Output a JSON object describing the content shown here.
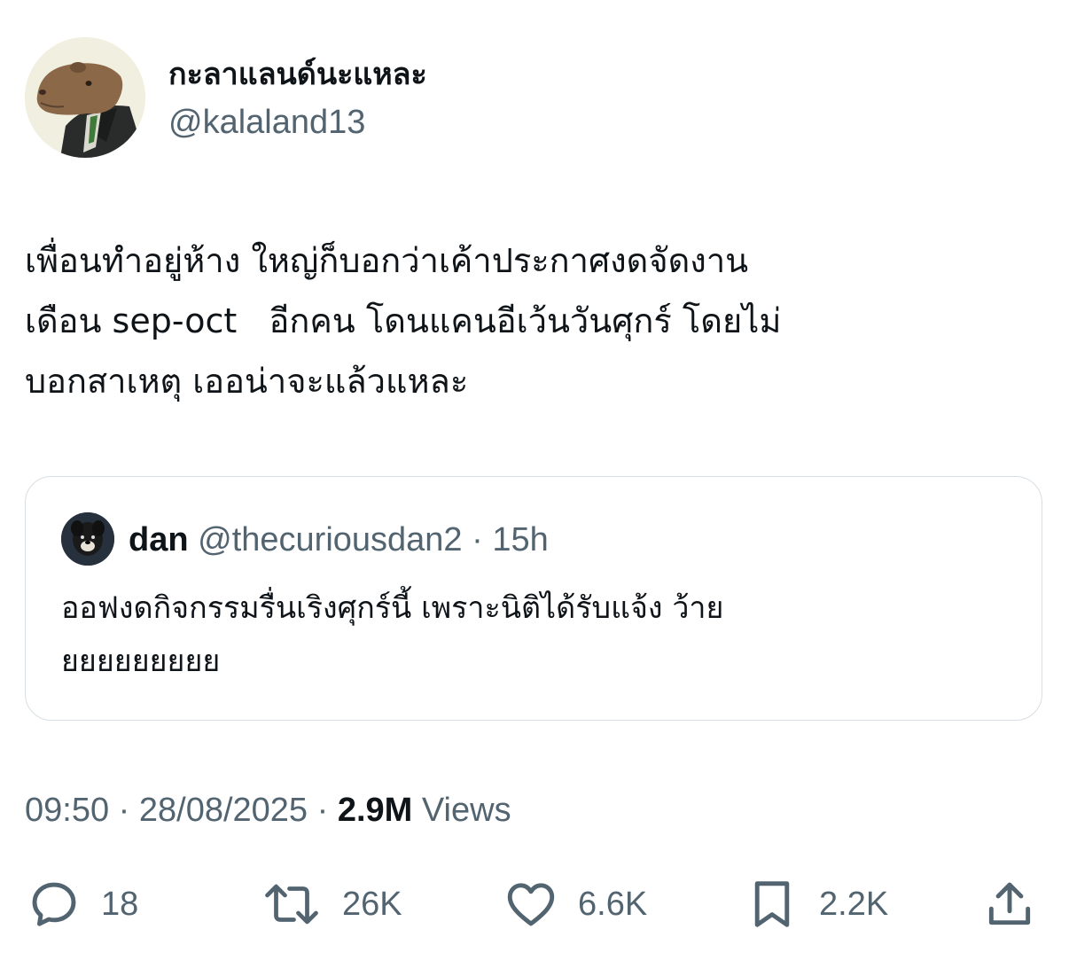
{
  "author": {
    "display_name": "กะลาแลนด์นะแหละ",
    "handle": "@kalaland13",
    "avatar_icon": "capybara-in-suit-avatar"
  },
  "tweet": {
    "lines": [
      "เพื่อนทำอยู่ห้าง ใหญ่ก็บอกว่าเค้าประกาศงดจัดงาน",
      "เดือน sep-oct   อีกคน โดนแคนอีเว้นวันศุกร์ โดยไม่",
      "บอกสาเหตุ เออน่าจะแล้วแหละ"
    ]
  },
  "quoted_tweet": {
    "name": "dan",
    "handle": "@thecuriousdan2",
    "separator": "·",
    "time": "15h",
    "avatar_icon": "dog-avatar",
    "lines": [
      "ออฟงดกิจกรรมรื่นเริงศุกร์นี้ เพราะนิติได้รับแจ้ง ว้าย",
      "ยยยยยยยยย"
    ]
  },
  "meta": {
    "time": "09:50",
    "sep1": "·",
    "date": "28/08/2025",
    "sep2": "·",
    "views_count": "2.9M",
    "views_label": "Views"
  },
  "actions": {
    "reply": {
      "icon": "reply-icon",
      "count": "18"
    },
    "retweet": {
      "icon": "retweet-icon",
      "count": "26K"
    },
    "like": {
      "icon": "heart-icon",
      "count": "6.6K"
    },
    "bookmark": {
      "icon": "bookmark-icon",
      "count": "2.2K"
    },
    "share": {
      "icon": "share-icon"
    }
  },
  "colors": {
    "text_primary": "#0f1419",
    "text_secondary": "#536471",
    "border": "#d8dee3",
    "icon": "#536471"
  }
}
